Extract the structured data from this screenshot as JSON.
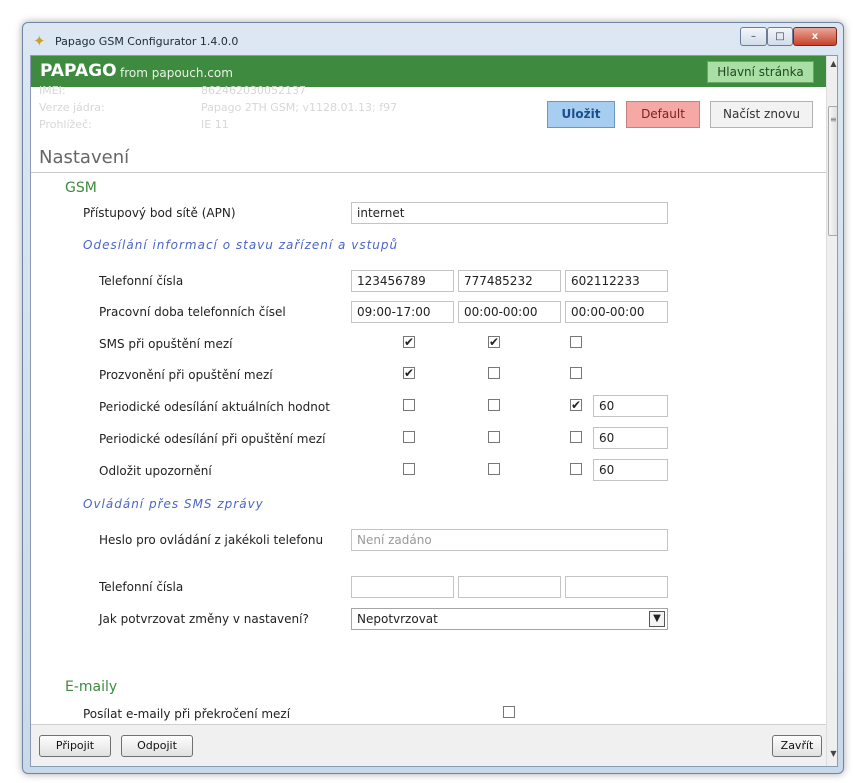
{
  "window": {
    "title": "Papago GSM Configurator 1.4.0.0",
    "min_glyph": "–",
    "max_glyph": "□",
    "close_glyph": "x"
  },
  "banner": {
    "brand": "PAPAGO",
    "sub": "from papouch.com",
    "home_label": "Hlavní stránka",
    "color": "#3e8a3f"
  },
  "faint_info": {
    "imei_label": "IMEI:",
    "imei_value": "862462030052137",
    "kernel_label": "Verze jádra:",
    "kernel_value": "Papago 2TH GSM; v1128.01.13; f97",
    "browser_label": "Prohlížeč:",
    "browser_value": "IE 11"
  },
  "actions": {
    "save": "Uložit",
    "default": "Default",
    "reload": "Načíst znovu"
  },
  "page_title": "Nastavení",
  "gsm": {
    "title": "GSM",
    "apn_label": "Přístupový bod sítě (APN)",
    "apn_value": "internet",
    "info_subtitle": "Odesílání informací o stavu zařízení a vstupů",
    "phones_label": "Telefonní čísla",
    "phones": [
      "123456789",
      "777485232",
      "602112233"
    ],
    "hours_label": "Pracovní doba telefonních čísel",
    "hours": [
      "09:00-17:00",
      "00:00-00:00",
      "00:00-00:00"
    ],
    "rows": [
      {
        "label": "SMS při opuštění mezí",
        "checks": [
          "✔",
          "✔",
          ""
        ]
      },
      {
        "label": "Prozvonění při opuštění mezí",
        "checks": [
          "✔",
          "",
          ""
        ]
      },
      {
        "label": "Periodické odesílání aktuálních hodnot",
        "checks": [
          "",
          "",
          "✔"
        ],
        "value": "60"
      },
      {
        "label": "Periodické odesílání při opuštění mezí",
        "checks": [
          "",
          "",
          ""
        ],
        "value": "60"
      },
      {
        "label": "Odložit upozornění",
        "checks": [
          "",
          "",
          ""
        ],
        "value": "60"
      }
    ],
    "sms_subtitle": "Ovládání přes SMS zprávy",
    "password_label": "Heslo pro ovládání z jakékoli telefonu",
    "password_placeholder": "Není zadáno",
    "sms_phones_label": "Telefonní čísla",
    "confirm_label": "Jak potvrzovat změny v nastavení?",
    "confirm_value": "Nepotvrzovat",
    "select_arrow": "▼"
  },
  "email": {
    "title": "E-maily",
    "send_label": "Posílat e-maily při překročení mezí",
    "send_check": ""
  },
  "bottom": {
    "connect": "Připojit",
    "disconnect": "Odpojit",
    "close": "Zavřít"
  },
  "scroll": {
    "up": "▲",
    "down": "▼",
    "grip": "≡"
  }
}
